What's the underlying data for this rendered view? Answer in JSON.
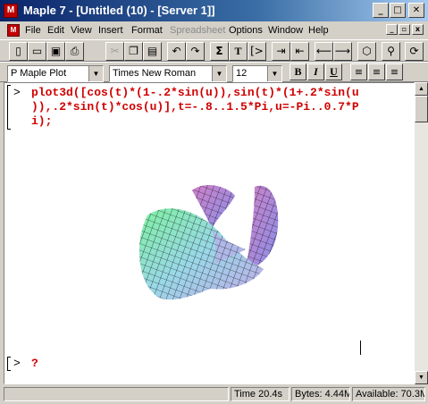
{
  "window": {
    "title": "Maple 7 - [Untitled (10) - [Server 1]]"
  },
  "menu": {
    "items": [
      "File",
      "Edit",
      "View",
      "Insert",
      "Format",
      "Spreadsheet",
      "Options",
      "Window",
      "Help"
    ],
    "disabled": [
      "Spreadsheet"
    ]
  },
  "toolbar": {
    "icons": [
      "new-icon",
      "open-icon",
      "save-icon",
      "print-icon",
      "cut-icon",
      "copy-icon",
      "paste-icon",
      "undo-icon",
      "redo-icon",
      "sigma-icon",
      "text-icon",
      "prompt-icon",
      "indent-icon",
      "outdent-icon",
      "back-icon",
      "forward-icon",
      "stop-icon",
      "zoom-icon",
      "restart-icon"
    ],
    "text_button": "T",
    "sigma_button": "Σ"
  },
  "format_bar": {
    "style": "P Maple Plot",
    "font": "Times New Roman",
    "size": "12",
    "bold": "B",
    "italic": "I",
    "underline": "U"
  },
  "worksheet": {
    "prompt": ">",
    "input_lines": [
      "plot3d([cos(t)*(1-.2*sin(u)),sin(t)*(1+.2*sin(u",
      ")),.2*sin(t)*cos(u)],t=-.8..1.5*Pi,u=-Pi..0.7*P",
      "i);"
    ],
    "prompt2": ">",
    "cursor_char": "?",
    "plot": {
      "type": "surface-3d",
      "colors": [
        "#7ef0a0",
        "#9ad8e8",
        "#c0a8e8",
        "#d080c8",
        "#8890e8"
      ]
    }
  },
  "status": {
    "time": "Time  20.4s",
    "bytes": "Bytes: 4.44M",
    "available": "Available: 70.3M"
  }
}
